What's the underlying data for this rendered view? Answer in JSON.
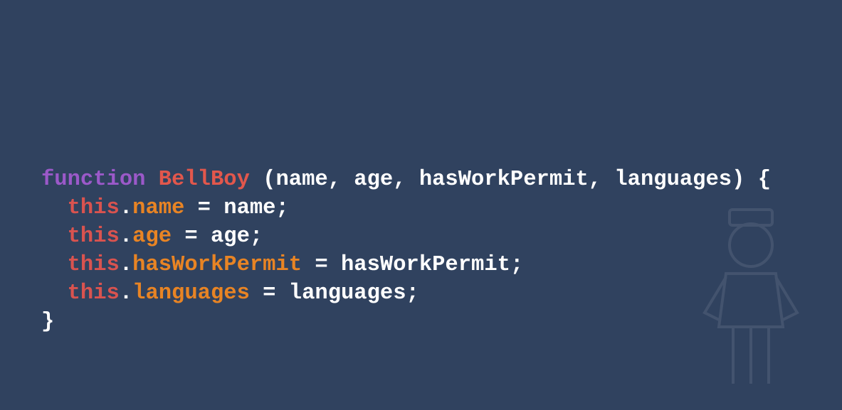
{
  "code": {
    "line1": {
      "keyword": "function",
      "space1": " ",
      "name": "BellBoy",
      "rest": " (name, age, hasWorkPermit, languages) {"
    },
    "line2": {
      "indent": "  ",
      "this": "this",
      "dot": ".",
      "prop": "name",
      "rest": " = name;"
    },
    "line3": {
      "indent": "  ",
      "this": "this",
      "dot": ".",
      "prop": "age",
      "rest": " = age;"
    },
    "line4": {
      "indent": "  ",
      "this": "this",
      "dot": ".",
      "prop": "hasWorkPermit",
      "rest": " = hasWorkPermit;"
    },
    "line5": {
      "indent": "  ",
      "this": "this",
      "dot": ".",
      "prop": "languages",
      "rest": " = languages;"
    },
    "line6": {
      "close": "}"
    }
  },
  "colors": {
    "background": "#30425f",
    "keyword": "#9b59c9",
    "function_name": "#e2574c",
    "this": "#d9534f",
    "property": "#e88424",
    "text": "#ffffff"
  },
  "icons": {
    "watermark": "bellboy-figure-icon"
  }
}
